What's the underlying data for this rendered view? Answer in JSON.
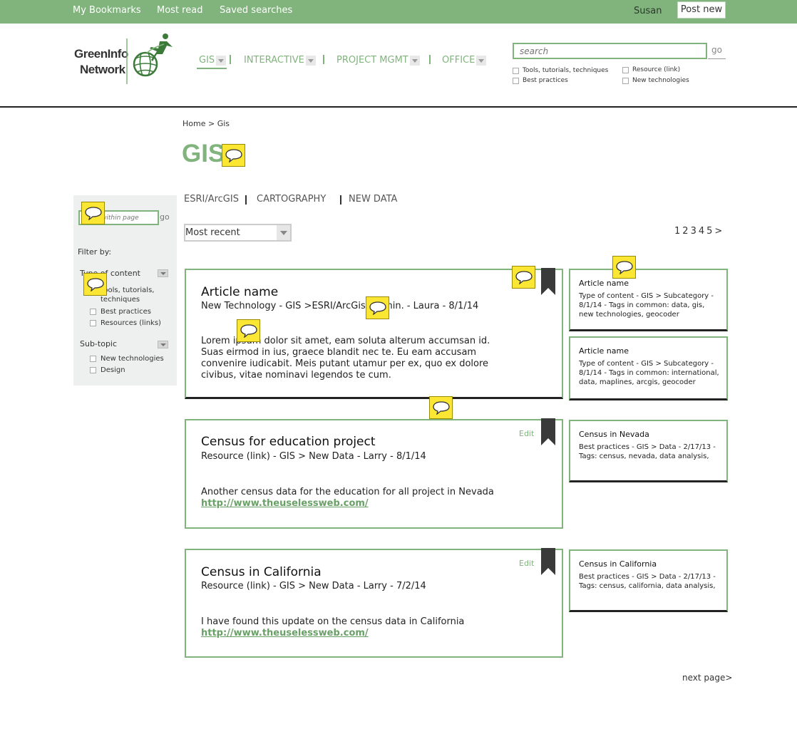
{
  "topbar": {
    "links": [
      "My Bookmarks",
      "Most read",
      "Saved searches"
    ],
    "user": "Susan",
    "post_new": "Post new"
  },
  "logo": {
    "line1": "GreenInfo",
    "line2": "Network"
  },
  "nav": {
    "items": [
      "GIS",
      "INTERACTIVE",
      "PROJECT MGMT",
      "OFFICE"
    ]
  },
  "search": {
    "placeholder": "search",
    "go": "go",
    "filters": [
      "Tools, tutorials, techniques",
      "Resource (link)",
      "Best practices",
      "New technologies"
    ]
  },
  "breadcrumb": {
    "home": "Home",
    "sep": ">",
    "current": "Gis"
  },
  "page_title": "GIS",
  "sidebar": {
    "search_placeholder": "within page",
    "go": "go",
    "filter_by": "Filter by:",
    "type_heading": "Type of content",
    "type_options": [
      "Tools, tutorials, techniques",
      "Best practices",
      "Resources (links)"
    ],
    "subtopic_heading": "Sub-topic",
    "subtopic_options": [
      "New technologies",
      "Design"
    ]
  },
  "subtabs": [
    "ESRI/ArcGIS",
    "CARTOGRAPHY",
    "NEW DATA"
  ],
  "sort": {
    "selected": "Most recent"
  },
  "pagination": {
    "pages": [
      "1",
      "2",
      "3",
      "4",
      "5"
    ],
    "next": ">"
  },
  "articles": [
    {
      "title": "Article name",
      "meta": "New Technology -  GIS >ESRI/ArcGis - 2 min.  - Laura -  8/1/14",
      "body": "Lorem ipsum dolor sit amet, eam soluta alterum accumsan id. Suas eirmod in ius, graece blandit nec te. Eu eam accusam convenire iudicabit. Meis putant utamur per ex, quo ex dolore civibus, vitae nominavi legendos te cum.",
      "link": "",
      "edit": ""
    },
    {
      "title": "Census for education project",
      "meta": "Resource (link)  -  GIS > New Data -  Larry - 8/1/14",
      "body": "Another census data for the education for all project in Nevada",
      "link": "http://www.theuselessweb.com/",
      "edit": "Edit"
    },
    {
      "title": "Census in California",
      "meta": "Resource (link)  -  GIS > New Data -  Larry - 7/2/14",
      "body": "I have found this update on the census data in California",
      "link": "http://www.theuselessweb.com/",
      "edit": "Edit"
    }
  ],
  "related": [
    {
      "title": "Article name",
      "meta": "Type of content  -  GIS > Subcategory  -  8/1/14 - Tags in common: data, gis, new technologies, geocoder"
    },
    {
      "title": "Article name",
      "meta": "Type of content  -  GIS > Subcategory  -  8/1/14 - Tags in common: international, data, maplines, arcgis, geocoder"
    },
    {
      "title": "Census in Nevada",
      "meta": "Best practices  -  GIS > Data - 2/17/13 -  Tags: census, nevada, data analysis,"
    },
    {
      "title": "Census in California",
      "meta": "Best practices  -  GIS > Data - 2/17/13 -  Tags: census, california, data analysis,"
    }
  ],
  "next_page": "next page>",
  "colors": {
    "brand_green": "#80b47c",
    "comment_yellow": "#fbe634",
    "bookmark": "#3a3a3a"
  },
  "icons": [
    "comment-icon",
    "bookmark-icon",
    "chevron-down-icon",
    "logo-globe-icon"
  ]
}
